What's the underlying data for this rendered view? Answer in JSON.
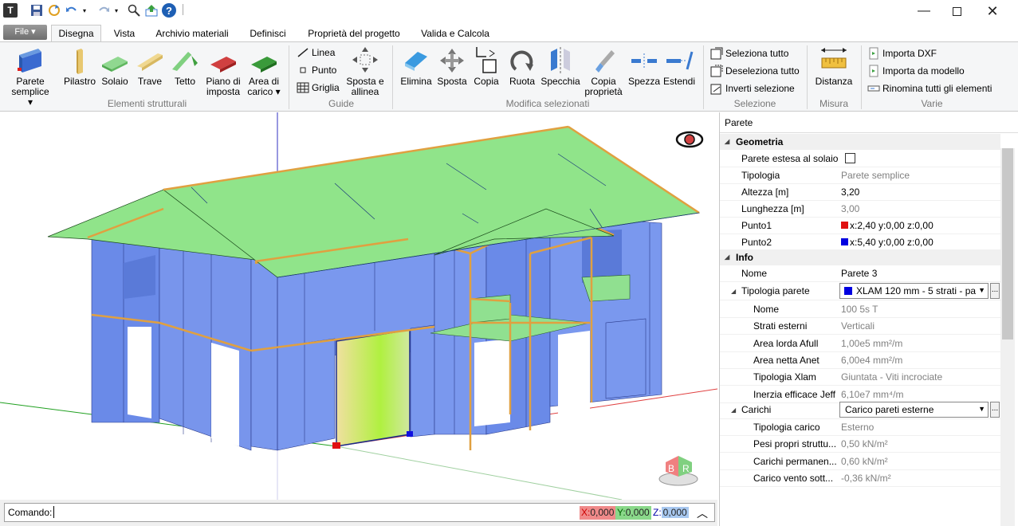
{
  "toolbar": {
    "file_label": "File"
  },
  "tabs": [
    "Disegna",
    "Vista",
    "Archivio materiali",
    "Definisci",
    "Proprietà del progetto",
    "Valida e Calcola"
  ],
  "ribbon": {
    "strutturali": {
      "parete": "Parete",
      "parete2": "semplice",
      "pilastro": "Pilastro",
      "solaio": "Solaio",
      "trave": "Trave",
      "tetto": "Tetto",
      "piano": "Piano di",
      "piano2": "imposta",
      "area": "Area di",
      "area2": "carico",
      "group": "Elementi strutturali"
    },
    "guide": {
      "linea": "Linea",
      "punto": "Punto",
      "griglia": "Griglia",
      "sposta": "Sposta e",
      "sposta2": "allinea",
      "group": "Guide"
    },
    "modifica": {
      "elimina": "Elimina",
      "sposta": "Sposta",
      "copia": "Copia",
      "ruota": "Ruota",
      "specchia": "Specchia",
      "copiaprop": "Copia",
      "copiaprop2": "proprietà",
      "spezza": "Spezza",
      "estendi": "Estendi",
      "group": "Modifica selezionati"
    },
    "selezione": {
      "tutto": "Seleziona tutto",
      "deseleziona": "Deseleziona tutto",
      "inverti": "Inverti selezione",
      "group": "Selezione"
    },
    "misura": {
      "distanza": "Distanza",
      "group": "Misura"
    },
    "varie": {
      "dxf": "Importa DXF",
      "modello": "Importa da modello",
      "rinomina": "Rinomina tutti gli elementi",
      "group": "Varie"
    }
  },
  "command": {
    "label": "Comando:",
    "x_label": "X:",
    "x": "0,000",
    "y_label": "Y:",
    "y": "0,000",
    "z_label": "Z:",
    "z": "0,000"
  },
  "panel": {
    "title": "Parete",
    "geometria": "Geometria",
    "rows_geo": [
      {
        "k": "Parete estesa al solaio",
        "v": ""
      },
      {
        "k": "Tipologia",
        "v": "Parete semplice"
      },
      {
        "k": "Altezza [m]",
        "v": "3,20"
      },
      {
        "k": "Lunghezza [m]",
        "v": "3,00"
      },
      {
        "k": "Punto1",
        "v": "x:2,40 y:0,00 z:0,00"
      },
      {
        "k": "Punto2",
        "v": "x:5,40 y:0,00 z:0,00"
      }
    ],
    "info": "Info",
    "nome_k": "Nome",
    "nome_v": "Parete 3",
    "tipparete_k": "Tipologia parete",
    "tipparete_v": "XLAM 120 mm - 5 strati - pa",
    "rows_sub": [
      {
        "k": "Nome",
        "v": "100 5s T"
      },
      {
        "k": "Strati esterni",
        "v": "Verticali"
      },
      {
        "k": "Area lorda Afull",
        "v": "1,00e5 mm²/m"
      },
      {
        "k": "Area netta Anet",
        "v": "6,00e4 mm²/m"
      },
      {
        "k": "Tipologia Xlam",
        "v": "Giuntata - Viti incrociate"
      },
      {
        "k": "Inerzia efficace Jeff",
        "v": "6,10e7 mm⁴/m"
      }
    ],
    "carichi_k": "Carichi",
    "carichi_v": "Carico pareti esterne",
    "rows_car": [
      {
        "k": "Tipologia carico",
        "v": "Esterno"
      },
      {
        "k": "Pesi propri struttu...",
        "v": "0,50 kN/m²"
      },
      {
        "k": "Carichi permanen...",
        "v": "0,60 kN/m²"
      },
      {
        "k": "Carico vento sott...",
        "v": "-0,36 kN/m²"
      }
    ]
  },
  "viewcube": {
    "b": "B",
    "r": "R"
  }
}
